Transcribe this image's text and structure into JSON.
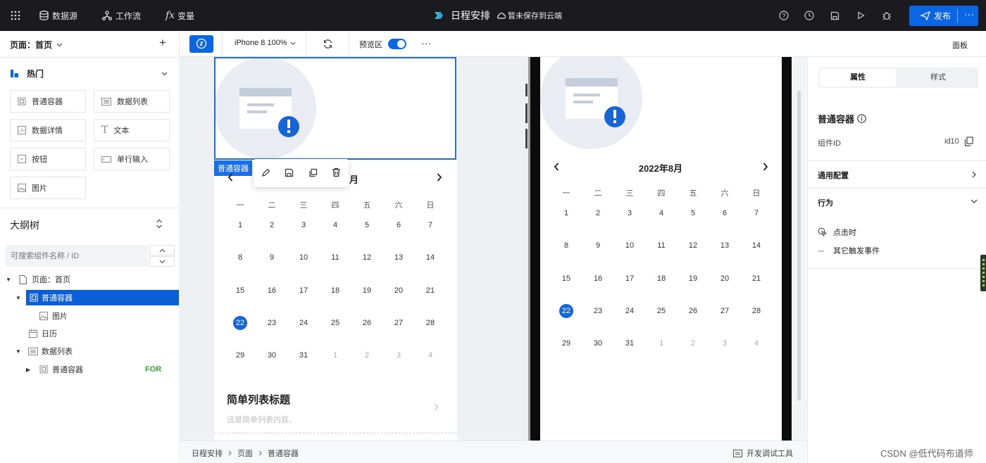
{
  "topbar": {
    "datasource": "数据源",
    "workflow": "工作流",
    "variables": "变量",
    "app_title": "日程安排",
    "save_status": "暂未保存到云端",
    "publish": "发布"
  },
  "left": {
    "page_selector": "页面：首页",
    "add": "+",
    "hot_section": "热门",
    "components": [
      "普通容器",
      "数据列表",
      "数据详情",
      "文本",
      "按钮",
      "单行输入",
      "图片"
    ],
    "outline_title": "大纲树",
    "search_placeholder": "可搜索组件名称 / ID",
    "tree": [
      {
        "label": "页面：首页"
      },
      {
        "label": "普通容器"
      },
      {
        "label": "图片"
      },
      {
        "label": "日历"
      },
      {
        "label": "数据列表"
      },
      {
        "label": "普通容器",
        "badge": "FOR"
      }
    ]
  },
  "toolbar": {
    "device": "iPhone 8 100%",
    "preview": "预览区",
    "more": "···",
    "panel": "面板"
  },
  "canvas": {
    "selected_tag": "普通容器",
    "left_month_suffix": "月",
    "right_month": "2022年8月",
    "weekdays": [
      "一",
      "二",
      "三",
      "四",
      "五",
      "六",
      "日"
    ],
    "weeks": [
      [
        "1",
        "2",
        "3",
        "4",
        "5",
        "6",
        "7"
      ],
      [
        "8",
        "9",
        "10",
        "11",
        "12",
        "13",
        "14"
      ],
      [
        "15",
        "16",
        "17",
        "18",
        "19",
        "20",
        "21"
      ],
      [
        "22",
        "23",
        "24",
        "25",
        "26",
        "27",
        "28"
      ],
      [
        "29",
        "30",
        "31",
        "1",
        "2",
        "3",
        "4"
      ]
    ],
    "selected_day": "22",
    "list_title": "简单列表标题",
    "list_desc": "这是简单列表内容。"
  },
  "right": {
    "tabs": [
      "属性",
      "样式"
    ],
    "component_name": "普通容器",
    "id_label": "组件ID",
    "id_value": "id10",
    "general_config": "通用配置",
    "behavior": "行为",
    "on_click": "点击时",
    "other_events": "其它触发事件"
  },
  "bottom": {
    "breadcrumb": [
      "日程安排",
      "页面",
      "普通容器"
    ],
    "dev_tools": "开发调试工具"
  },
  "watermark": "CSDN @低代码布道师",
  "colors": {
    "accent": "#0b66e4",
    "topbar": "#1b1b1f",
    "selected_day": "#1665d8",
    "for_badge": "#35a335"
  }
}
